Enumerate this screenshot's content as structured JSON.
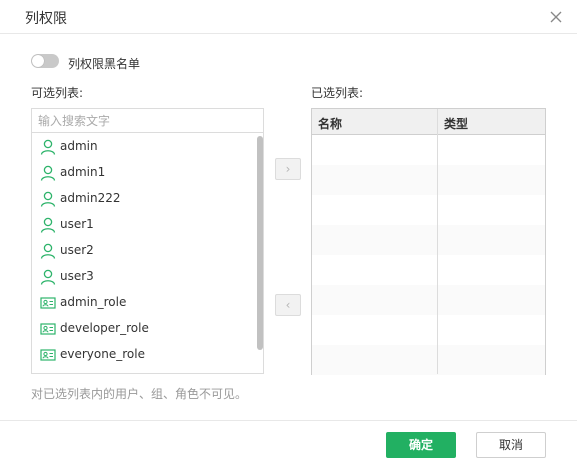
{
  "dialog": {
    "title": "列权限",
    "close_icon": "close-icon"
  },
  "blacklist_toggle": {
    "label": "列权限黑名单",
    "enabled": false
  },
  "available": {
    "label": "可选列表:",
    "search_placeholder": "输入搜索文字",
    "items": [
      {
        "label": "admin",
        "icon": "user-icon"
      },
      {
        "label": "admin1",
        "icon": "user-icon"
      },
      {
        "label": "admin222",
        "icon": "user-icon"
      },
      {
        "label": "user1",
        "icon": "user-icon"
      },
      {
        "label": "user2",
        "icon": "user-icon"
      },
      {
        "label": "user3",
        "icon": "user-icon"
      },
      {
        "label": "admin_role",
        "icon": "role-icon"
      },
      {
        "label": "developer_role",
        "icon": "role-icon"
      },
      {
        "label": "everyone_role",
        "icon": "role-icon"
      }
    ]
  },
  "transfer": {
    "add_glyph": "›",
    "remove_glyph": "‹"
  },
  "selected": {
    "label": "已选列表:",
    "columns": [
      "名称",
      "类型"
    ],
    "rows": []
  },
  "hint": "对已选列表内的用户、组、角色不可见。",
  "footer": {
    "ok_label": "确定",
    "cancel_label": "取消"
  },
  "colors": {
    "accent": "#22b062",
    "icon_green": "#2db36a"
  }
}
